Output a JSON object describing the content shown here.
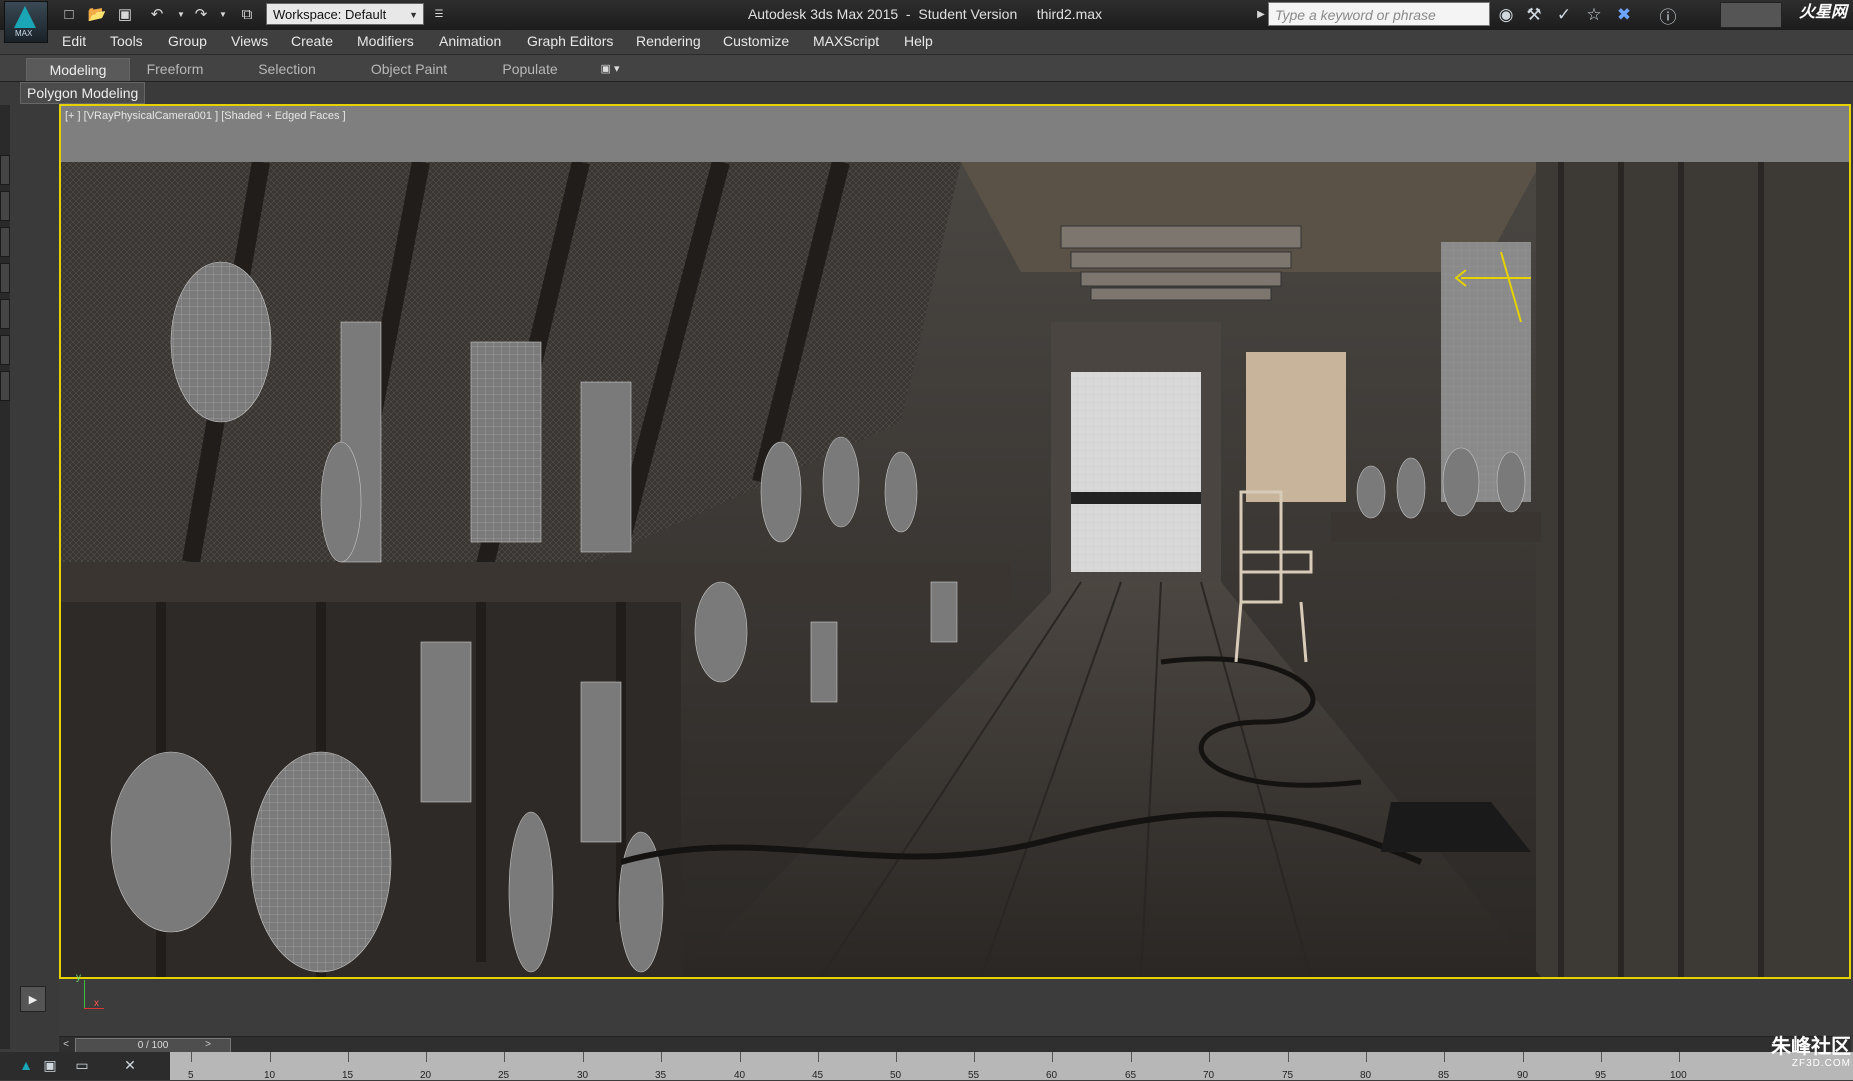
{
  "app": {
    "badge": "MAX"
  },
  "title": {
    "app_name": "Autodesk 3ds Max  2015",
    "edition": "Student Version",
    "file": "third2.max"
  },
  "workspace": {
    "label": "Workspace: Default"
  },
  "search": {
    "placeholder": "Type a keyword or phrase"
  },
  "menu": [
    "Edit",
    "Tools",
    "Group",
    "Views",
    "Create",
    "Modifiers",
    "Animation",
    "Graph Editors",
    "Rendering",
    "Customize",
    "MAXScript",
    "Help"
  ],
  "ribbon": {
    "tabs": [
      "Modeling",
      "Freeform",
      "Selection",
      "Object Paint",
      "Populate"
    ],
    "active_tab": "Modeling",
    "panel": "Polygon Modeling"
  },
  "viewport": {
    "label": "[+ ] [VRayPhysicalCamera001 ] [Shaded + Edged Faces ]"
  },
  "timeline": {
    "frame": "0 / 100",
    "ticks": [
      "5",
      "10",
      "15",
      "20",
      "25",
      "30",
      "35",
      "40",
      "45",
      "50",
      "55",
      "60",
      "65",
      "70",
      "75",
      "80",
      "85",
      "90",
      "95",
      "100"
    ]
  },
  "axis": {
    "x": "x",
    "y": "y"
  },
  "watermark": {
    "name": "朱峰社区",
    "url": "ZF3D.COM"
  },
  "brand": {
    "text": "火星网"
  },
  "colors": {
    "viewport_border": "#e5d200",
    "accent": "#1aa6b7"
  }
}
